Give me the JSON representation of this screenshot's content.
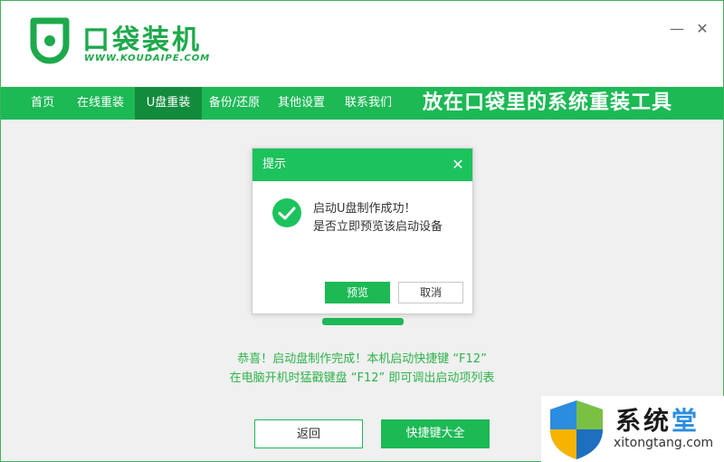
{
  "app": {
    "brand": "口袋装机",
    "url": "WWW.KOUDAIPE.COM"
  },
  "window_controls": {
    "minimize": "—",
    "close": "✕"
  },
  "nav": {
    "items": [
      {
        "label": "首页"
      },
      {
        "label": "在线重装"
      },
      {
        "label": "U盘重装",
        "active": true
      },
      {
        "label": "备份/还原"
      },
      {
        "label": "其他设置"
      },
      {
        "label": "联系我们"
      }
    ],
    "slogan": "放在口袋里的系统重装工具"
  },
  "dialog": {
    "title": "提示",
    "close": "✕",
    "message_line1": "启动U盘制作成功！",
    "message_line2": "是否立即预览该启动设备",
    "preview_label": "预览",
    "cancel_label": "取消"
  },
  "notice": {
    "line1": "恭喜！启动盘制作完成！本机启动快捷键 “F12”",
    "line2": "在电脑开机时猛戳键盘 “F12” 即可调出启动项列表"
  },
  "buttons": {
    "back_label": "返回",
    "shortcuts_label": "快捷键大全"
  },
  "watermark": {
    "title_part1": "系统",
    "title_part2": "堂",
    "url": "xitongtang.com"
  },
  "colors": {
    "brand_green": "#1cb955",
    "nav_active": "#128b3d",
    "notice_text": "#2fb34a"
  }
}
